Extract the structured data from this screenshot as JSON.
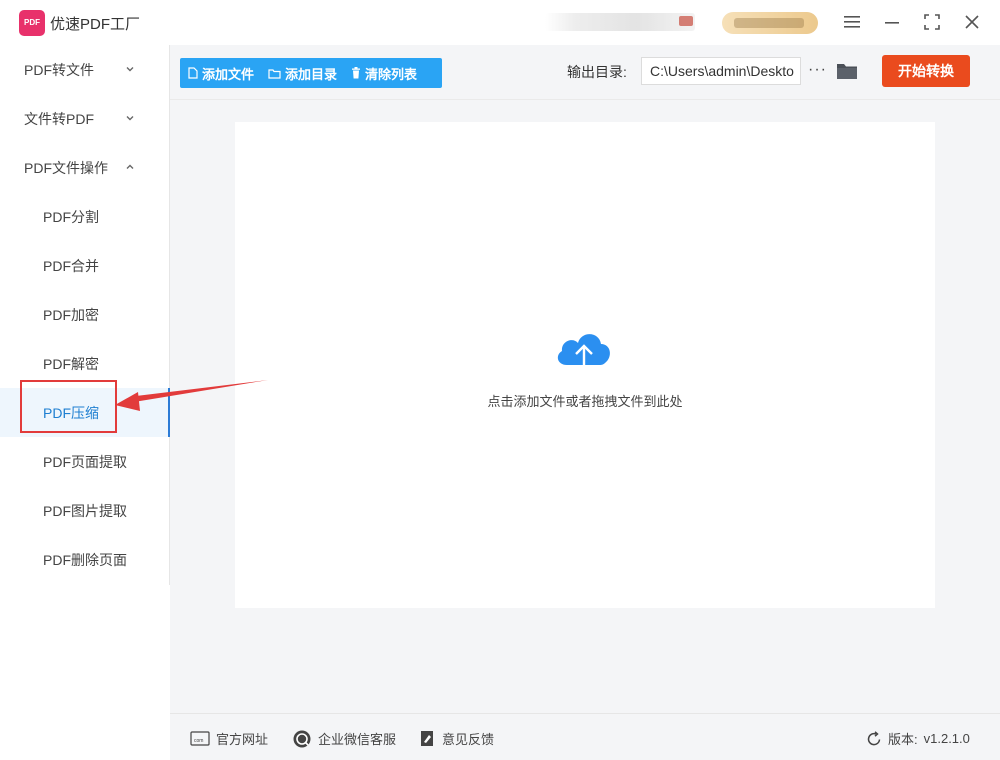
{
  "app": {
    "title": "优速PDF工厂",
    "logo_text": "PDF"
  },
  "window_controls": [
    "menu-icon",
    "minimize-icon",
    "maximize-icon",
    "close-icon"
  ],
  "sidebar": {
    "groups": [
      {
        "label": "PDF转文件",
        "expanded": false
      },
      {
        "label": "文件转PDF",
        "expanded": false
      },
      {
        "label": "PDF文件操作",
        "expanded": true
      }
    ],
    "sub_items": [
      {
        "label": "PDF分割"
      },
      {
        "label": "PDF合并"
      },
      {
        "label": "PDF加密"
      },
      {
        "label": "PDF解密"
      },
      {
        "label": "PDF压缩",
        "active": true
      },
      {
        "label": "PDF页面提取"
      },
      {
        "label": "PDF图片提取"
      },
      {
        "label": "PDF删除页面"
      }
    ]
  },
  "toolbar": {
    "add_file": "添加文件",
    "add_folder": "添加目录",
    "clear_list": "清除列表",
    "output_label": "输出目录:",
    "output_path": "C:\\Users\\admin\\Deskto",
    "more": "···",
    "start": "开始转换"
  },
  "dropzone": {
    "hint": "点击添加文件或者拖拽文件到此处"
  },
  "footer": {
    "website": "官方网址",
    "wechat": "企业微信客服",
    "feedback": "意见反馈",
    "version_label": "版本:",
    "version": "v1.2.1.0"
  },
  "colors": {
    "accent_blue": "#2aa4f4",
    "start_button": "#ea4b1e",
    "logo": "#e8316b",
    "annotation_red": "#e23b3b"
  }
}
